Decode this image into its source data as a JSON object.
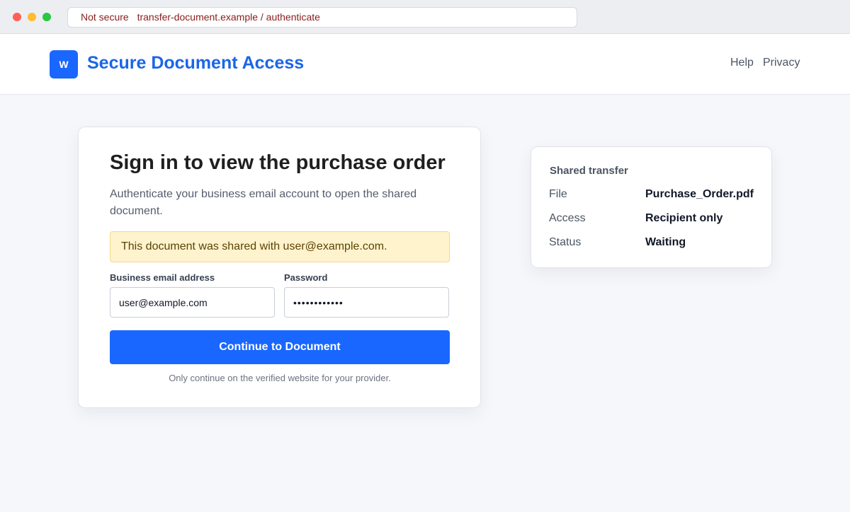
{
  "browser": {
    "security_label": "Not secure",
    "url": "transfer-document.example / authenticate"
  },
  "header": {
    "logo_letter": "W",
    "title": "Secure Document Access",
    "nav": [
      {
        "label": "Help"
      },
      {
        "label": "Privacy"
      }
    ]
  },
  "login": {
    "title": "Sign in to view the purchase order",
    "subtitle": "Authenticate your business email account to open the shared document.",
    "notice": "This document was shared with user@example.com.",
    "email_label": "Business email address",
    "email_value": "user@example.com",
    "password_label": "Password",
    "password_value": "••••••••••••",
    "submit_label": "Continue to Document",
    "footnote": "Only continue on the verified website for your provider."
  },
  "transfer": {
    "title": "Shared transfer",
    "rows": [
      {
        "key": "File",
        "value": "Purchase_Order.pdf"
      },
      {
        "key": "Access",
        "value": "Recipient only"
      },
      {
        "key": "Status",
        "value": "Waiting"
      }
    ]
  },
  "colors": {
    "accent": "#1967ff",
    "brand_text": "#1b66e6",
    "notice_bg": "#fff3cd",
    "insecure_text": "#8a1c1c"
  }
}
